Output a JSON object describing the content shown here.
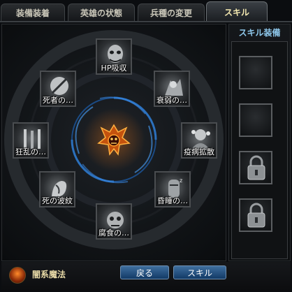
{
  "tabs": [
    {
      "label": "装備装着",
      "active": false
    },
    {
      "label": "英雄の状態",
      "active": false
    },
    {
      "label": "兵種の変更",
      "active": false
    },
    {
      "label": "スキル",
      "active": true
    }
  ],
  "skill_tree": {
    "skills": [
      {
        "label": "HP吸収",
        "icon": "hp-drain-icon"
      },
      {
        "label": "衰弱の…",
        "icon": "weaken-icon"
      },
      {
        "label": "疫病拡散",
        "icon": "plague-spread-icon"
      },
      {
        "label": "昏睡の…",
        "icon": "coma-icon"
      },
      {
        "label": "腐食の…",
        "icon": "corrosion-icon"
      },
      {
        "label": "死の波紋",
        "icon": "death-ripple-icon"
      },
      {
        "label": "狂乱の…",
        "icon": "frenzy-icon"
      },
      {
        "label": "死者の…",
        "icon": "dead-icon"
      }
    ],
    "center_icon": "dark-magic-emblem-icon"
  },
  "equip_panel": {
    "title": "スキル装備",
    "slots": [
      {
        "state": "empty"
      },
      {
        "state": "empty"
      },
      {
        "state": "locked",
        "icon": "lock-icon"
      },
      {
        "state": "locked",
        "icon": "lock-icon"
      }
    ]
  },
  "bottom": {
    "element_icon": "dark-magic-icon",
    "element_label": "闇系魔法",
    "back_label": "戻る",
    "skill_label": "スキル"
  },
  "colors": {
    "accent_blue": "#2f7fd8",
    "title_cyan": "#8fc8ec",
    "button_blue": "#1d4f84"
  }
}
